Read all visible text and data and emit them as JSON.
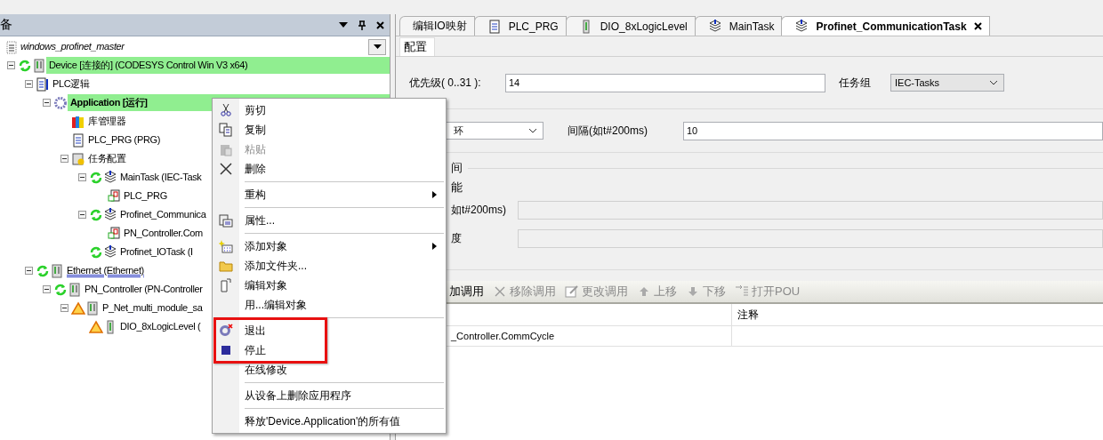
{
  "left_panel": {
    "title": "备",
    "tree": [
      {
        "label": "windows_profinet_master",
        "kind": "project",
        "online": false,
        "warning": false,
        "highlighted": false,
        "active": false,
        "underlined": false,
        "children": [
          {
            "label": "Device [连接的] (CODESYS Control Win V3 x64)",
            "kind": "device",
            "online": true,
            "warning": false,
            "highlighted": true,
            "active": false,
            "underlined": false,
            "expanded": true,
            "children": [
              {
                "label": "PLC逻辑",
                "kind": "plc-logic",
                "online": false,
                "warning": false,
                "highlighted": false,
                "active": false,
                "underlined": false,
                "expanded": true,
                "children": [
                  {
                    "label": "Application [运行]",
                    "kind": "application",
                    "online": false,
                    "warning": false,
                    "highlighted": true,
                    "active": true,
                    "underlined": false,
                    "expanded": true,
                    "children": [
                      {
                        "label": "库管理器",
                        "kind": "library",
                        "online": false,
                        "warning": false,
                        "highlighted": false,
                        "active": false,
                        "underlined": false
                      },
                      {
                        "label": "PLC_PRG (PRG)",
                        "kind": "pou",
                        "online": false,
                        "warning": false,
                        "highlighted": false,
                        "active": false,
                        "underlined": false
                      },
                      {
                        "label": "任务配置",
                        "kind": "task-config",
                        "online": false,
                        "warning": false,
                        "highlighted": false,
                        "active": false,
                        "underlined": false,
                        "expanded": true,
                        "children": [
                          {
                            "label": "MainTask (IEC-Task",
                            "kind": "task",
                            "online": true,
                            "warning": false,
                            "highlighted": false,
                            "active": false,
                            "underlined": false,
                            "expanded": true,
                            "children": [
                              {
                                "label": "PLC_PRG",
                                "kind": "program-call",
                                "online": false,
                                "warning": false,
                                "highlighted": false,
                                "active": false,
                                "underlined": false
                              }
                            ]
                          },
                          {
                            "label": "Profinet_Communica",
                            "kind": "task",
                            "online": true,
                            "warning": false,
                            "highlighted": false,
                            "active": false,
                            "underlined": false,
                            "expanded": true,
                            "children": [
                              {
                                "label": "PN_Controller.Com",
                                "kind": "program-call",
                                "online": false,
                                "warning": false,
                                "highlighted": false,
                                "active": false,
                                "underlined": false
                              }
                            ]
                          },
                          {
                            "label": "Profinet_IOTask (I",
                            "kind": "task",
                            "online": true,
                            "warning": false,
                            "highlighted": false,
                            "active": false,
                            "underlined": false
                          }
                        ]
                      }
                    ]
                  }
                ]
              },
              {
                "label": "Ethernet (Ethernet)",
                "kind": "device",
                "online": true,
                "warning": false,
                "highlighted": false,
                "active": false,
                "underlined": true,
                "expanded": true,
                "children": [
                  {
                    "label": "PN_Controller (PN-Controller",
                    "kind": "device",
                    "online": true,
                    "warning": false,
                    "highlighted": false,
                    "active": false,
                    "underlined": false,
                    "expanded": true,
                    "children": [
                      {
                        "label": "P_Net_multi_module_sa",
                        "kind": "device",
                        "online": false,
                        "warning": true,
                        "highlighted": false,
                        "active": false,
                        "underlined": false,
                        "expanded": true,
                        "children": [
                          {
                            "label": "DIO_8xLogicLevel (",
                            "kind": "module",
                            "online": false,
                            "warning": true,
                            "highlighted": false,
                            "active": false,
                            "underlined": false
                          }
                        ]
                      }
                    ]
                  }
                ]
              }
            ]
          }
        ]
      }
    ]
  },
  "editor": {
    "tabs": [
      {
        "label": "编辑IO映射",
        "kind": "mapping",
        "selected": false
      },
      {
        "label": "PLC_PRG",
        "kind": "pou",
        "selected": false
      },
      {
        "label": "DIO_8xLogicLevel",
        "kind": "device",
        "selected": false
      },
      {
        "label": "MainTask",
        "kind": "task",
        "selected": false
      },
      {
        "label": "Profinet_CommunicationTask",
        "kind": "task",
        "selected": true
      }
    ],
    "subtabs": [
      {
        "label": "配置",
        "selected": true
      }
    ],
    "priority": {
      "label": "优先级( 0..31 ):",
      "value": "14"
    },
    "task_group": {
      "label": "任务组",
      "value": "IEC-Tasks"
    },
    "type": {
      "value": "环"
    },
    "interval": {
      "label": "间隔(如t#200ms)",
      "value": "10"
    },
    "section": {
      "heading": "间",
      "option": "能",
      "fields": [
        {
          "label": "如t#200ms)",
          "disabled": true
        },
        {
          "label": "度",
          "disabled": true
        }
      ]
    },
    "toolbar": [
      {
        "label": "加调用",
        "kind": "text",
        "disabled": false
      },
      {
        "label": "移除调用",
        "kind": "remove",
        "disabled": true
      },
      {
        "label": "更改调用",
        "kind": "edit",
        "disabled": true
      },
      {
        "label": "上移",
        "kind": "up",
        "disabled": true
      },
      {
        "label": "下移",
        "kind": "down",
        "disabled": true
      },
      {
        "label": "打开POU",
        "kind": "open",
        "disabled": true
      }
    ],
    "table": {
      "column_2": "注释",
      "rows": [
        {
          "column_1": "_Controller.CommCycle"
        }
      ]
    }
  },
  "context_menu": [
    {
      "kind": "item",
      "label": "剪切",
      "disabled": false,
      "submenu": false,
      "boxed": false
    },
    {
      "kind": "item",
      "label": "复制",
      "disabled": false,
      "submenu": false,
      "boxed": false
    },
    {
      "kind": "item",
      "label": "粘贴",
      "disabled": true,
      "submenu": false,
      "boxed": false
    },
    {
      "kind": "item",
      "label": "删除",
      "disabled": false,
      "submenu": false,
      "boxed": false
    },
    {
      "kind": "separator"
    },
    {
      "kind": "item",
      "label": "重构",
      "disabled": false,
      "submenu": true,
      "boxed": false
    },
    {
      "kind": "separator"
    },
    {
      "kind": "item",
      "label": "属性...",
      "disabled": false,
      "submenu": false,
      "boxed": false
    },
    {
      "kind": "separator"
    },
    {
      "kind": "item",
      "label": "添加对象",
      "disabled": false,
      "submenu": true,
      "boxed": false
    },
    {
      "kind": "item",
      "label": "添加文件夹...",
      "disabled": false,
      "submenu": false,
      "boxed": false
    },
    {
      "kind": "item",
      "label": "编辑对象",
      "disabled": false,
      "submenu": false,
      "boxed": false
    },
    {
      "kind": "item",
      "label": "用...编辑对象",
      "disabled": false,
      "submenu": false,
      "boxed": false
    },
    {
      "kind": "separator"
    },
    {
      "kind": "item",
      "label": "退出",
      "disabled": false,
      "submenu": false,
      "boxed": true
    },
    {
      "kind": "item",
      "label": "停止",
      "disabled": false,
      "submenu": false,
      "boxed": true
    },
    {
      "kind": "item",
      "label": "在线修改",
      "disabled": false,
      "submenu": false,
      "boxed": false
    },
    {
      "kind": "separator"
    },
    {
      "kind": "item",
      "label": "从设备上删除应用程序",
      "disabled": false,
      "submenu": false,
      "boxed": false
    },
    {
      "kind": "separator"
    },
    {
      "kind": "item",
      "label": "释放'Device.Application'的所有值",
      "disabled": false,
      "submenu": false,
      "boxed": false
    }
  ]
}
